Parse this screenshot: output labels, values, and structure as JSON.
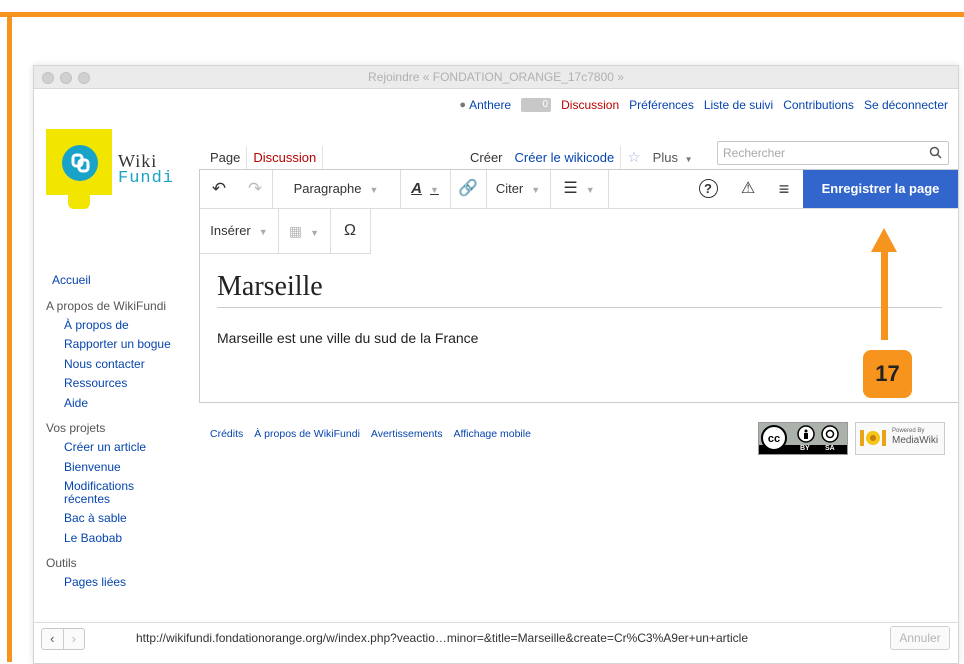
{
  "window": {
    "title": "Rejoindre « FONDATION_ORANGE_17c7800 »"
  },
  "personal": {
    "username": "Anthere",
    "notification_count": "0",
    "links": [
      "Discussion",
      "Préférences",
      "Liste de suivi",
      "Contributions",
      "Se déconnecter"
    ]
  },
  "logo": {
    "line1": "Wiki",
    "line2": "Fundi"
  },
  "tabs": {
    "page": "Page",
    "discussion": "Discussion",
    "create": "Créer",
    "create_wikicode": "Créer le wikicode",
    "more": "Plus"
  },
  "search": {
    "placeholder": "Rechercher"
  },
  "toolbar": {
    "paragraph": "Paragraphe",
    "cite": "Citer",
    "insert": "Insérer",
    "save": "Enregistrer la page",
    "special_char": "Ω",
    "help": "?",
    "warning": "⚠",
    "menu": "≡"
  },
  "content": {
    "title": "Marseille",
    "text": "Marseille est une ville du sud de la France"
  },
  "sidebar": {
    "home": "Accueil",
    "section1": {
      "heading": "A propos de WikiFundi",
      "items": [
        "À propos de",
        "Rapporter un bogue",
        "Nous contacter",
        "Ressources",
        "Aide"
      ]
    },
    "section2": {
      "heading": "Vos projets",
      "items": [
        "Créer un article",
        "Bienvenue",
        "Modifications récentes",
        "Bac à sable",
        "Le Baobab"
      ]
    },
    "section3": {
      "heading": "Outils",
      "items": [
        "Pages liées"
      ]
    }
  },
  "footer": {
    "links": [
      "Crédits",
      "À propos de WikiFundi",
      "Avertissements",
      "Affichage mobile"
    ],
    "cc_text": [
      "BY",
      "SA"
    ],
    "mw_text": [
      "Powered By",
      "MediaWiki"
    ]
  },
  "status": {
    "url": "http://wikifundi.fondationorange.org/w/index.php?veactio…minor=&title=Marseille&create=Cr%C3%A9er+un+article",
    "cancel": "Annuler"
  },
  "callout": {
    "label": "17"
  },
  "colors": {
    "accent": "#f7941d",
    "save_button": "#3366cc",
    "link": "#0645ad",
    "discussion_tab": "#ba0000"
  }
}
